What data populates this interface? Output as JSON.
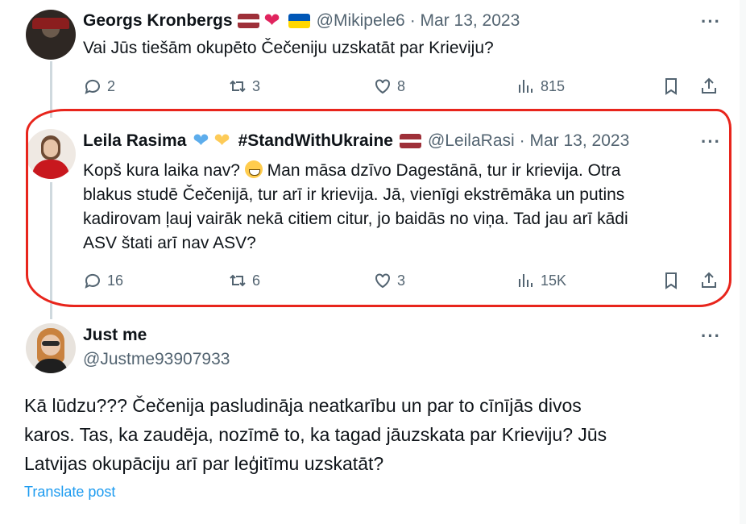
{
  "tweets": [
    {
      "name": "Georgs Kronbergs",
      "handle": "@Mikipele6",
      "date": "· Mar 13, 2023",
      "text": "Vai Jūs tiešām okupēto Čečeniju uzskatāt par Krieviju?",
      "replies": "2",
      "reposts": "3",
      "likes": "8",
      "views": "815"
    },
    {
      "name": "Leila Rasima",
      "hashtag": "#StandWithUkraine",
      "handle": "@LeilaRasi",
      "date": "· Mar 13, 2023",
      "text_lines": [
        "Kopš kura laika nav?",
        "Man māsa dzīvo Dagestānā, tur ir krievija. Otra",
        "blakus studē Čečenijā, tur arī ir krievija. Jā, vienīgi ekstrēmāka un putins",
        "kadirovam ļauj vairāk nekā citiem citur, jo baidās no viņa. Tad jau arī kādi",
        "ASV štati arī nav ASV?"
      ],
      "replies": "16",
      "reposts": "6",
      "likes": "3",
      "views": "15K"
    },
    {
      "name": "Just me",
      "handle": "@Justme93907933",
      "text_lines": [
        "Kā lūdzu??? Čečenija pasludināja neatkarību un par to cīnījās divos",
        "karos. Tas, ka zaudēja, nozīmē to, ka tagad jāuzskata par Krieviju? Jūs",
        "Latvijas okupāciju arī par leģitīmu uzskatāt?"
      ],
      "translate": "Translate post"
    }
  ],
  "colors": {
    "highlight": "#e8251c",
    "link": "#1d9bf0",
    "muted": "#536471"
  },
  "icons": {
    "reply": "reply-icon",
    "repost": "repost-icon",
    "like": "heart-icon",
    "views": "views-icon",
    "bookmark": "bookmark-icon",
    "share": "share-icon",
    "more": "more-icon"
  }
}
